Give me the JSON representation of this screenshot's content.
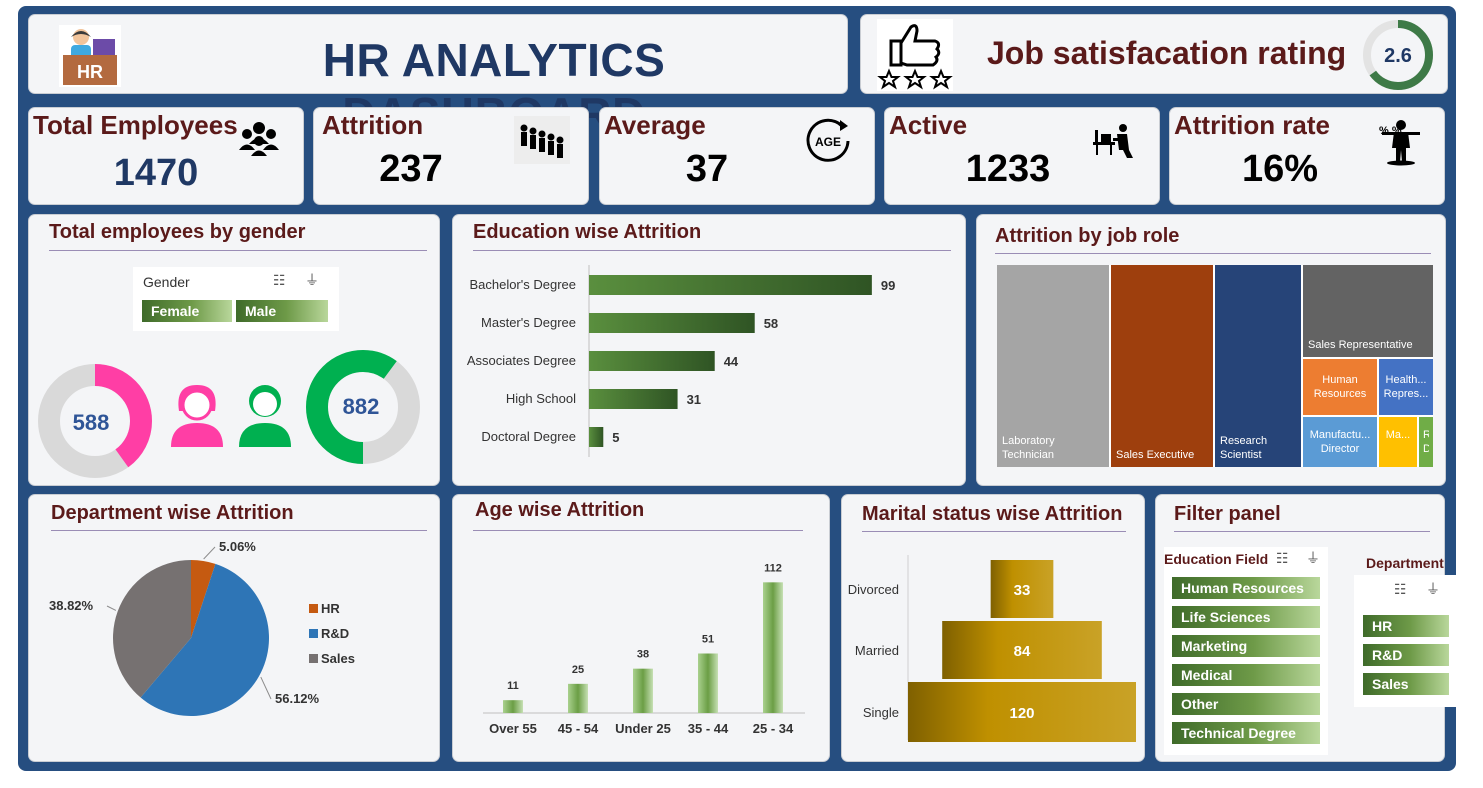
{
  "header": {
    "title": "HR ANALYTICS DASHBOARD",
    "logo_text": "HR"
  },
  "job_satisfaction": {
    "label": "Job satisfacation rating",
    "value": "2.6",
    "fraction": 0.65
  },
  "kpis": [
    {
      "label": "Total Employees",
      "value": "1470",
      "color": "#1F3864",
      "icon": "people-group-icon"
    },
    {
      "label": "Attrition",
      "value": "237",
      "color": "#000000",
      "icon": "people-leaving-icon"
    },
    {
      "label": "Average",
      "value": "37",
      "color": "#000000",
      "icon": "age-icon",
      "icon_text": "AGE"
    },
    {
      "label": "Active",
      "value": "1233",
      "color": "#000000",
      "icon": "desk-worker-icon"
    },
    {
      "label": "Attrition rate",
      "value": "16%",
      "color": "#000000",
      "icon": "person-percent-icon",
      "icon_text": "% %"
    }
  ],
  "gender": {
    "title": "Total employees by gender",
    "slicer": {
      "header": "Gender",
      "options": [
        "Female",
        "Male"
      ]
    },
    "female": {
      "value": 588,
      "color": "#FF3EA5"
    },
    "male": {
      "value": 882,
      "color": "#00B050"
    },
    "total": 1470
  },
  "education": {
    "title": "Education wise Attrition",
    "chart_data": {
      "type": "bar",
      "orientation": "horizontal",
      "categories": [
        "Bachelor's Degree",
        "Master's Degree",
        "Associates Degree",
        "High School",
        "Doctoral Degree"
      ],
      "values": [
        99,
        58,
        44,
        31,
        5
      ],
      "xlim": [
        0,
        105
      ]
    }
  },
  "job_role": {
    "title": "Attrition by job role",
    "chart_data": {
      "type": "treemap",
      "items": [
        {
          "label": "Laboratory Technician",
          "color": "#A5A5A5"
        },
        {
          "label": "Sales Executive",
          "color": "#9E3F0D"
        },
        {
          "label": "Research Scientist",
          "color": "#264478"
        },
        {
          "label": "Sales Representative",
          "color": "#636363"
        },
        {
          "label": "Human Resources",
          "color": "#ED7D31"
        },
        {
          "label": "Health... Repres...",
          "color": "#4472C4"
        },
        {
          "label": "Manufactu... Director",
          "color": "#5B9BD5"
        },
        {
          "label": "Ma...",
          "color": "#FFC000"
        },
        {
          "label": "R... D...",
          "color": "#70AD47"
        }
      ]
    }
  },
  "department": {
    "title": "Department wise Attrition",
    "chart_data": {
      "type": "pie",
      "categories": [
        "HR",
        "R&D",
        "Sales"
      ],
      "values": [
        5.06,
        56.12,
        38.82
      ],
      "labels": [
        "5.06%",
        "56.12%",
        "38.82%"
      ],
      "colors": [
        "#C55A11",
        "#2E75B6",
        "#767171"
      ],
      "legend": "right"
    }
  },
  "age": {
    "title": "Age wise Attrition",
    "chart_data": {
      "type": "bar",
      "categories": [
        "Over 55",
        "45 - 54",
        "Under 25",
        "35 - 44",
        "25 - 34"
      ],
      "values": [
        11,
        25,
        38,
        51,
        112
      ],
      "ylim": [
        0,
        120
      ]
    }
  },
  "marital": {
    "title": "Marital status wise Attrition",
    "chart_data": {
      "type": "bar",
      "orientation": "horizontal-centered",
      "categories": [
        "Divorced",
        "Married",
        "Single"
      ],
      "values": [
        33,
        84,
        120
      ],
      "xlim": [
        0,
        120
      ]
    }
  },
  "filter_panel": {
    "title": "Filter panel",
    "education_field": {
      "header": "Education Field",
      "options": [
        "Human Resources",
        "Life Sciences",
        "Marketing",
        "Medical",
        "Other",
        "Technical Degree"
      ]
    },
    "department": {
      "header": "Department",
      "options": [
        "HR",
        "R&D",
        "Sales"
      ]
    }
  }
}
